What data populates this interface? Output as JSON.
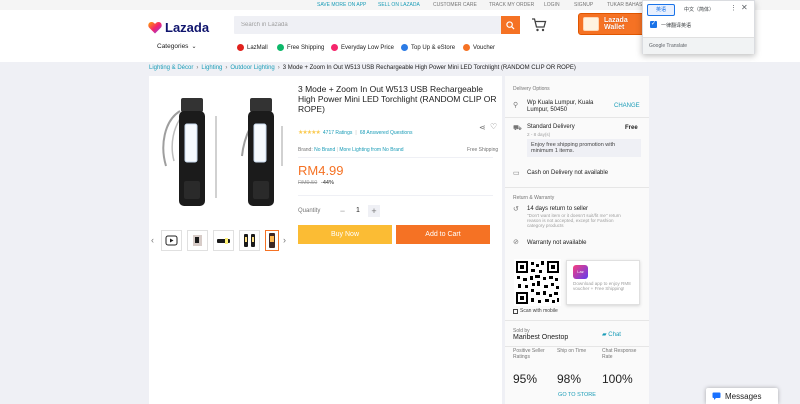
{
  "topbar": {
    "links": [
      "SAVE MORE ON APP",
      "SELL ON LAZADA",
      "CUSTOMER CARE",
      "TRACK MY ORDER",
      "LOGIN",
      "SIGNUP",
      "TUKAR BAHASA"
    ]
  },
  "header": {
    "logo": "Lazada",
    "search_placeholder": "Search in Lazada",
    "wallet": {
      "line1": "Lazada",
      "line2": "Wallet"
    }
  },
  "nav": {
    "categories": "Categories",
    "items": [
      "LazMall",
      "Free Shipping",
      "Everyday Low Price",
      "Top Up & eStore",
      "Voucher"
    ]
  },
  "breadcrumb": {
    "links": [
      "Lighting & Décor",
      "Lighting",
      "Outdoor Lighting"
    ],
    "current": "3 Mode + Zoom In Out W513 USB Rechargeable High Power Mini LED Torchlight (RANDOM CLIP OR ROPE)"
  },
  "product": {
    "title": "3 Mode + Zoom In Out W513 USB Rechargeable High Power Mini LED Torchlight (RANDOM CLIP OR ROPE)",
    "stars": "★★★★★",
    "ratings": "4717 Ratings",
    "rating_sep": "|",
    "answered": "68 Answered Questions",
    "brand_label": "Brand:",
    "brand": "No Brand",
    "brand_sep": "|",
    "more_from": "More Lighting from No Brand",
    "free_shipping": "Free Shipping",
    "price": "RM4.99",
    "old_price": "RM9.50",
    "discount": "-44%",
    "quantity_label": "Quantity",
    "quantity": "1",
    "minus": "−",
    "plus": "+",
    "buy_now": "Buy Now",
    "add_to_cart": "Add to Cart"
  },
  "sidebar": {
    "delivery_title": "Delivery Options",
    "location_line1": "Wp Kuala Lumpur, Kuala",
    "location_line2": "Lumpur, 50450",
    "change": "CHANGE",
    "standard": "Standard Delivery",
    "standard_days": "2 - 8 day(s)",
    "standard_price": "Free",
    "promo_line1": "Enjoy free shipping promotion with",
    "promo_line2": "minimum 1 items.",
    "cod": "Cash on Delivery not available",
    "return_title": "Return & Warranty",
    "return_days": "14 days return to seller",
    "return_note1": "\"Don't want item or it doesn't suit/fit me\" return",
    "return_note2": "reason is not accepted, except for Fashion",
    "return_note3": "category products",
    "warranty": "Warranty not available",
    "app_logo": "Laz",
    "app_text": "Download app to enjoy RM8 voucher + Free Shipping!",
    "scan": "Scan with mobile",
    "sold_by": "Sold by",
    "seller": "Maribest Onestop",
    "chat": "Chat",
    "metrics": [
      {
        "label": "Positive Seller Ratings",
        "value": "95%"
      },
      {
        "label": "Ship on Time",
        "value": "98%"
      },
      {
        "label": "Chat Response Rate",
        "value": "100%"
      }
    ],
    "go_to_store": "GO TO STORE"
  },
  "translate": {
    "tab_active": "英语",
    "tab_other": "中文（简体）",
    "more": "⋮",
    "close": "✕",
    "checkbox": "一律翻译英语",
    "brand": "Google Translate"
  },
  "messages": {
    "label": "Messages"
  },
  "colors": {
    "brand_orange": "#f57224",
    "link_blue": "#1a9cb7",
    "buy_yellow": "#fbbc34",
    "navy": "#0f146d"
  }
}
